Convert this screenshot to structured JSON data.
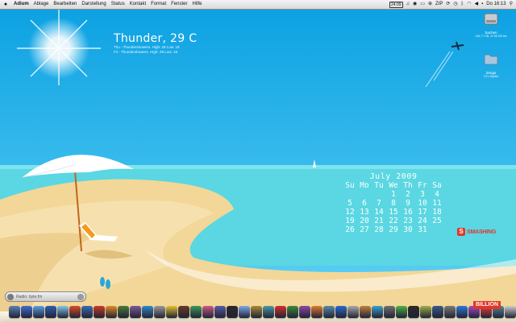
{
  "menubar": {
    "app_name": "Adium",
    "menus": [
      "Ablage",
      "Bearbeiten",
      "Darstellung",
      "Status",
      "Kontakt",
      "Format",
      "Fenster",
      "Hilfe"
    ],
    "status_items": [
      "24:09",
      "ZIP",
      "Do 16:13"
    ]
  },
  "weather": {
    "now": "Thunder, 29 C",
    "forecast": [
      "Thu - Thundershowers. High: 29 Low: 19",
      "Fri - Thundershowers. High: 29 Low: 18"
    ]
  },
  "calendar": {
    "month": "July 2009",
    "weekdays": [
      "Su",
      "Mo",
      "Tu",
      "We",
      "Th",
      "Fr",
      "Sa"
    ],
    "weeks": [
      [
        "",
        "",
        "",
        "1",
        "2",
        "3",
        "4"
      ],
      [
        "5",
        "6",
        "7",
        "8",
        "9",
        "10",
        "11"
      ],
      [
        "12",
        "13",
        "14",
        "15",
        "16",
        "17",
        "18"
      ],
      [
        "19",
        "20",
        "21",
        "22",
        "23",
        "24",
        "25"
      ],
      [
        "26",
        "27",
        "28",
        "29",
        "30",
        "31",
        ""
      ]
    ]
  },
  "desktop_icons": [
    {
      "label": "Sachen",
      "sub": "148,77 GB, 37,58 GB frei",
      "icon": "hard-drive-icon"
    },
    {
      "label": "Zeugs",
      "sub": "170 Objekte",
      "icon": "folder-icon"
    }
  ],
  "brand": {
    "smashing": "SMASHING",
    "billion": "BILLION",
    "s_letter": "S"
  },
  "radio": {
    "label": "Radio: byte.fm"
  },
  "colors": {
    "sky_top": "#0aa6e6",
    "sky_bottom": "#5fd3f5",
    "sea": "#56d6e0",
    "sand": "#f4d89a",
    "accent_red": "#e2362a"
  },
  "dock": {
    "colors": [
      "#5a7fb8",
      "#3c6fd6",
      "#5aa0e8",
      "#2d5fb0",
      "#7dc6ee",
      "#d84a2a",
      "#3a6cb8",
      "#cc3a2a",
      "#e08a2a",
      "#4a7a3a",
      "#7a5a9a",
      "#2a8acc",
      "#9a9a9a",
      "#e0c030",
      "#6a3a2a",
      "#3a9a5a",
      "#cc5a8a",
      "#5a5aaa",
      "#2a2a2a",
      "#7aaaee",
      "#aa8a3a",
      "#4a9aaa",
      "#d03030",
      "#3a8a3a",
      "#8a4aaa",
      "#e07a30",
      "#5a8aaa",
      "#2a6acc",
      "#aaa",
      "#c08040",
      "#3aa0d0",
      "#707070",
      "#4ab04a",
      "#2a2a2a",
      "#9ab04a",
      "#3a5a8a",
      "#7a7a7a",
      "#2a7adc",
      "#a04ad0",
      "#e04040",
      "#4a8a9a",
      "#cccccc"
    ]
  }
}
